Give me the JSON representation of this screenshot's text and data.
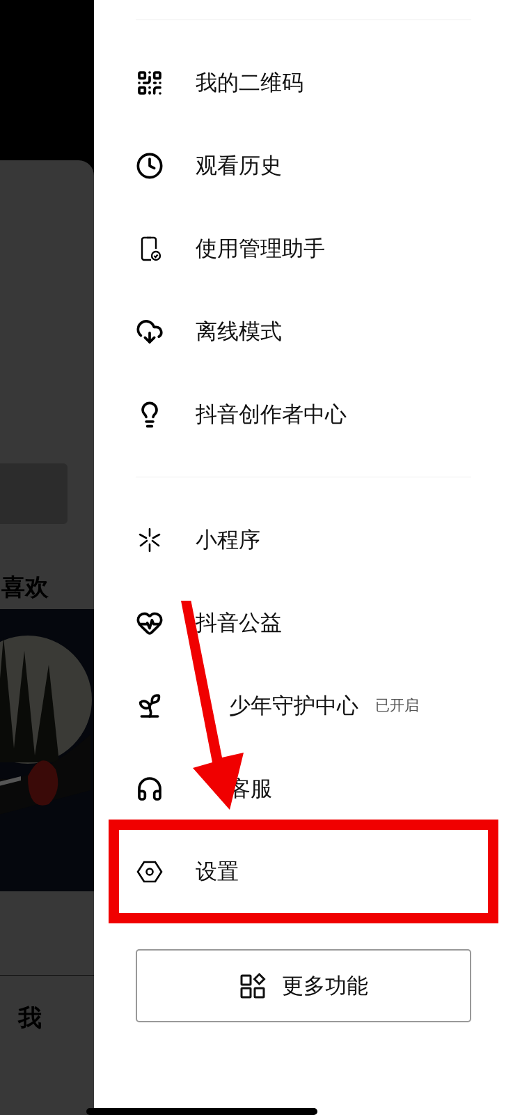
{
  "background_panel": {
    "heading": "喜欢",
    "tab_label": "我"
  },
  "sections": [
    {
      "items": [
        {
          "label": "我的二维码",
          "highlighted": false
        },
        {
          "label": "观看历史",
          "highlighted": false
        },
        {
          "label": "使用管理助手",
          "highlighted": false
        },
        {
          "label": "离线模式",
          "highlighted": false
        },
        {
          "label": "抖音创作者中心",
          "highlighted": false
        }
      ]
    },
    {
      "items": [
        {
          "label": "小程序",
          "highlighted": false
        },
        {
          "label": "抖音公益",
          "highlighted": false
        },
        {
          "label": "少年守护中心",
          "partly_covered": true,
          "status": "已开启",
          "highlighted": false
        },
        {
          "label": "客服",
          "partly_covered": true,
          "highlighted": false
        },
        {
          "label": "设置",
          "highlighted": true
        }
      ]
    }
  ],
  "more_button": {
    "label": "更多功能"
  }
}
